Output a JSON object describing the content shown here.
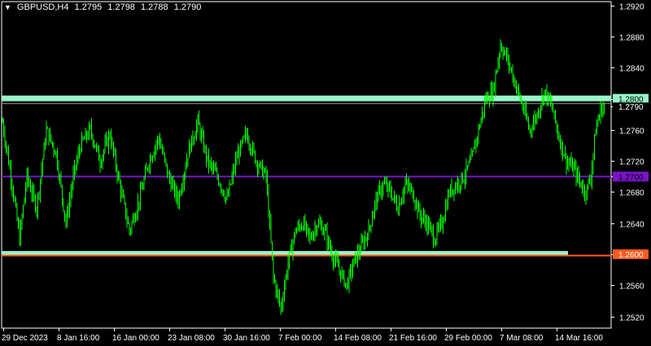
{
  "header": {
    "symbol": "GBPUSD,H4",
    "open": "1.2795",
    "high": "1.2798",
    "low": "1.2788",
    "close": "1.2790",
    "menu_icon": "triangle-down-icon"
  },
  "colors": {
    "background": "#000000",
    "grid_frame": "#ffffff",
    "candles": "#00ff00",
    "level_1": "#98f5c8",
    "level_2": "#7a14c8",
    "level_3_band": "#98f5c8",
    "level_3_red": "#ff5a1e",
    "current_price_tag": "#9ad99a"
  },
  "chart_data": {
    "type": "candlestick",
    "symbol": "GBPUSD",
    "timeframe": "H4",
    "ylim": [
      1.2505,
      1.2925
    ],
    "y_ticks": [
      "1.2920",
      "1.2880",
      "1.2840",
      "1.2800",
      "1.2790",
      "1.2760",
      "1.2720",
      "1.2700",
      "1.2680",
      "1.2640",
      "1.2600",
      "1.2560",
      "1.2520"
    ],
    "x_ticks": [
      "29 Dec 2023",
      "8 Jan 16:00",
      "16 Jan 00:00",
      "23 Jan 08:00",
      "30 Jan 16:00",
      "7 Feb 00:00",
      "14 Feb 08:00",
      "21 Feb 16:00",
      "29 Feb 00:00",
      "7 Mar 08:00",
      "14 Mar 16:00"
    ],
    "levels": [
      {
        "price": 1.28,
        "label": "1.2800",
        "style": "band"
      },
      {
        "price": 1.27,
        "label": "1.2700",
        "style": "line"
      },
      {
        "price": 1.26,
        "label": "1.2600",
        "style": "band-red"
      }
    ],
    "current_price": {
      "price": 1.279,
      "label": "1.2790"
    },
    "close_path": [
      [
        0,
        1.277
      ],
      [
        8,
        1.269
      ],
      [
        14,
        1.262
      ],
      [
        20,
        1.27
      ],
      [
        28,
        1.266
      ],
      [
        36,
        1.276
      ],
      [
        44,
        1.273
      ],
      [
        52,
        1.264
      ],
      [
        58,
        1.27
      ],
      [
        64,
        1.274
      ],
      [
        72,
        1.276
      ],
      [
        80,
        1.272
      ],
      [
        88,
        1.2755
      ],
      [
        96,
        1.269
      ],
      [
        104,
        1.263
      ],
      [
        112,
        1.267
      ],
      [
        120,
        1.272
      ],
      [
        128,
        1.275
      ],
      [
        136,
        1.27
      ],
      [
        144,
        1.267
      ],
      [
        152,
        1.273
      ],
      [
        160,
        1.277
      ],
      [
        168,
        1.272
      ],
      [
        176,
        1.27
      ],
      [
        184,
        1.267
      ],
      [
        192,
        1.2725
      ],
      [
        200,
        1.2755
      ],
      [
        208,
        1.272
      ],
      [
        216,
        1.27
      ],
      [
        222,
        1.257
      ],
      [
        228,
        1.253
      ],
      [
        234,
        1.259
      ],
      [
        240,
        1.263
      ],
      [
        246,
        1.264
      ],
      [
        252,
        1.262
      ],
      [
        258,
        1.264
      ],
      [
        264,
        1.263
      ],
      [
        270,
        1.26
      ],
      [
        276,
        1.258
      ],
      [
        282,
        1.256
      ],
      [
        288,
        1.259
      ],
      [
        294,
        1.261
      ],
      [
        300,
        1.263
      ],
      [
        306,
        1.267
      ],
      [
        312,
        1.269
      ],
      [
        318,
        1.268
      ],
      [
        324,
        1.266
      ],
      [
        330,
        1.269
      ],
      [
        336,
        1.268
      ],
      [
        342,
        1.265
      ],
      [
        348,
        1.264
      ],
      [
        354,
        1.262
      ],
      [
        360,
        1.264
      ],
      [
        366,
        1.268
      ],
      [
        372,
        1.269
      ],
      [
        378,
        1.27
      ],
      [
        384,
        1.272
      ],
      [
        390,
        1.276
      ],
      [
        396,
        1.28
      ],
      [
        402,
        1.281
      ],
      [
        408,
        1.287
      ],
      [
        414,
        1.285
      ],
      [
        420,
        1.282
      ],
      [
        426,
        1.279
      ],
      [
        432,
        1.276
      ],
      [
        438,
        1.278
      ],
      [
        444,
        1.281
      ],
      [
        450,
        1.279
      ],
      [
        456,
        1.275
      ],
      [
        462,
        1.272
      ],
      [
        468,
        1.271
      ],
      [
        474,
        1.269
      ],
      [
        478,
        1.268
      ],
      [
        482,
        1.27
      ],
      [
        486,
        1.276
      ],
      [
        490,
        1.2785
      ],
      [
        493,
        1.279
      ]
    ]
  }
}
